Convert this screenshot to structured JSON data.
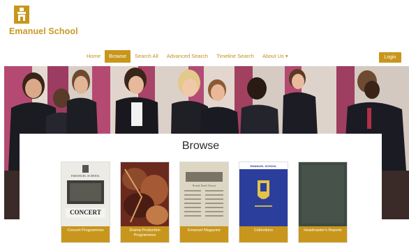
{
  "brand": {
    "name": "Emanuel School",
    "accent": "#c8961c"
  },
  "nav": {
    "items": [
      {
        "label": "Home",
        "active": false
      },
      {
        "label": "Browse",
        "active": true
      },
      {
        "label": "Search All",
        "active": false
      },
      {
        "label": "Advanced Search",
        "active": false
      },
      {
        "label": "Timeline Search",
        "active": false
      },
      {
        "label": "About Us ▾",
        "active": false
      }
    ],
    "login_label": "Login"
  },
  "browse": {
    "title": "Browse",
    "cards": [
      {
        "label": "Concert Programmes",
        "thumb_header": "EMANUEL SCHOOL",
        "thumb_word": "CONCERT"
      },
      {
        "label": "Drama Production Programmes"
      },
      {
        "label": "Emanuel Magazine",
        "thumb_header": "Portal Steel Tower"
      },
      {
        "label": "Collections",
        "thumb_header": "EMANUEL SCHOOL"
      },
      {
        "label": "Headmaster's Reports"
      }
    ]
  }
}
